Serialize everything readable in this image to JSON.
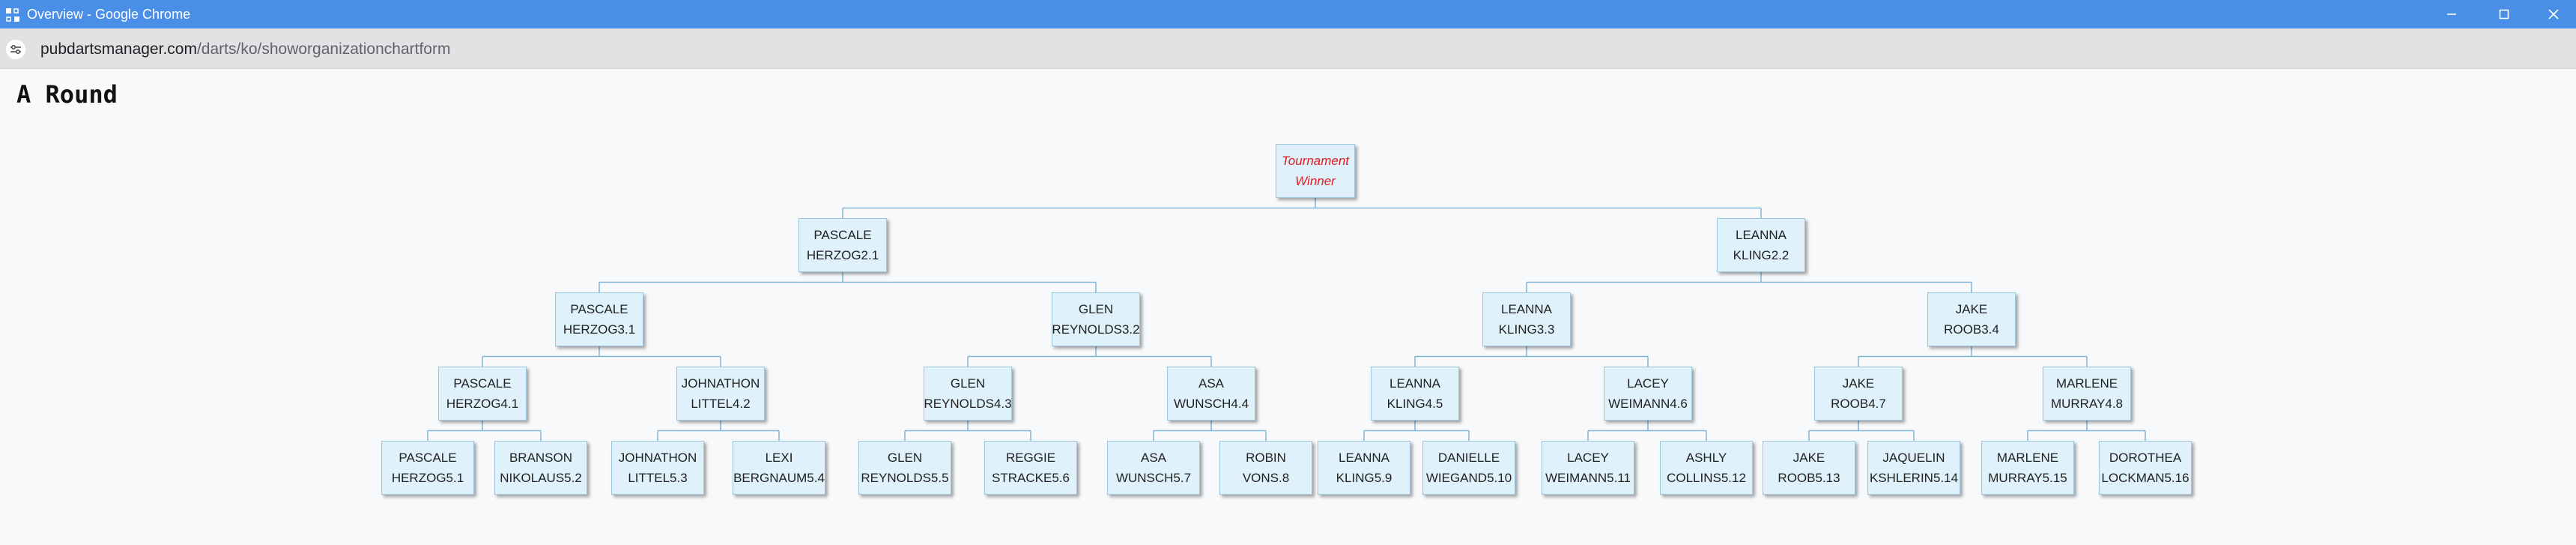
{
  "window": {
    "title": "Overview - Google Chrome"
  },
  "address": {
    "domain": "pubdartsmanager.com",
    "path": "/darts/ko/showorganizationchartform"
  },
  "page": {
    "title": "A  Round"
  },
  "colors": {
    "titlebar": "#4a8fe7",
    "node_fill": "#dff1fa",
    "node_border": "#9ec6dd",
    "connector": "#7fb4d6",
    "winner_text": "#e0191f"
  },
  "icons": {
    "app": "chrome-app-icon",
    "site_settings": "tune-icon",
    "minimize": "minimize-icon",
    "maximize": "maximize-icon",
    "close": "close-icon"
  },
  "bracket": {
    "winner": {
      "line1": "Tournament",
      "line2": "Winner"
    },
    "round2": [
      {
        "first": "PASCALE",
        "last": "HERZOG2.1"
      },
      {
        "first": "LEANNA",
        "last": "KLING2.2"
      }
    ],
    "round3": [
      {
        "first": "PASCALE",
        "last": "HERZOG3.1"
      },
      {
        "first": "GLEN",
        "last": "REYNOLDS3.2"
      },
      {
        "first": "LEANNA",
        "last": "KLING3.3"
      },
      {
        "first": "JAKE",
        "last": "ROOB3.4"
      }
    ],
    "round4": [
      {
        "first": "PASCALE",
        "last": "HERZOG4.1"
      },
      {
        "first": "JOHNATHON",
        "last": "LITTEL4.2"
      },
      {
        "first": "GLEN",
        "last": "REYNOLDS4.3"
      },
      {
        "first": "ASA",
        "last": "WUNSCH4.4"
      },
      {
        "first": "LEANNA",
        "last": "KLING4.5"
      },
      {
        "first": "LACEY",
        "last": "WEIMANN4.6"
      },
      {
        "first": "JAKE",
        "last": "ROOB4.7"
      },
      {
        "first": "MARLENE",
        "last": "MURRAY4.8"
      }
    ],
    "round5": [
      {
        "first": "PASCALE",
        "last": "HERZOG5.1"
      },
      {
        "first": "BRANSON",
        "last": "NIKOLAUS5.2"
      },
      {
        "first": "JOHNATHON",
        "last": "LITTEL5.3"
      },
      {
        "first": "LEXI",
        "last": "BERGNAUM5.4"
      },
      {
        "first": "GLEN",
        "last": "REYNOLDS5.5"
      },
      {
        "first": "REGGIE",
        "last": "STRACKE5.6"
      },
      {
        "first": "ASA",
        "last": "WUNSCH5.7"
      },
      {
        "first": "ROBIN",
        "last": "VONS.8"
      },
      {
        "first": "LEANNA",
        "last": "KLING5.9"
      },
      {
        "first": "DANIELLE",
        "last": "WIEGAND5.10"
      },
      {
        "first": "LACEY",
        "last": "WEIMANN5.11"
      },
      {
        "first": "ASHLY",
        "last": "COLLINS5.12"
      },
      {
        "first": "JAKE",
        "last": "ROOB5.13"
      },
      {
        "first": "JAQUELIN",
        "last": "KSHLERIN5.14"
      },
      {
        "first": "MARLENE",
        "last": "MURRAY5.15"
      },
      {
        "first": "DOROTHEA",
        "last": "LOCKMAN5.16"
      }
    ]
  }
}
